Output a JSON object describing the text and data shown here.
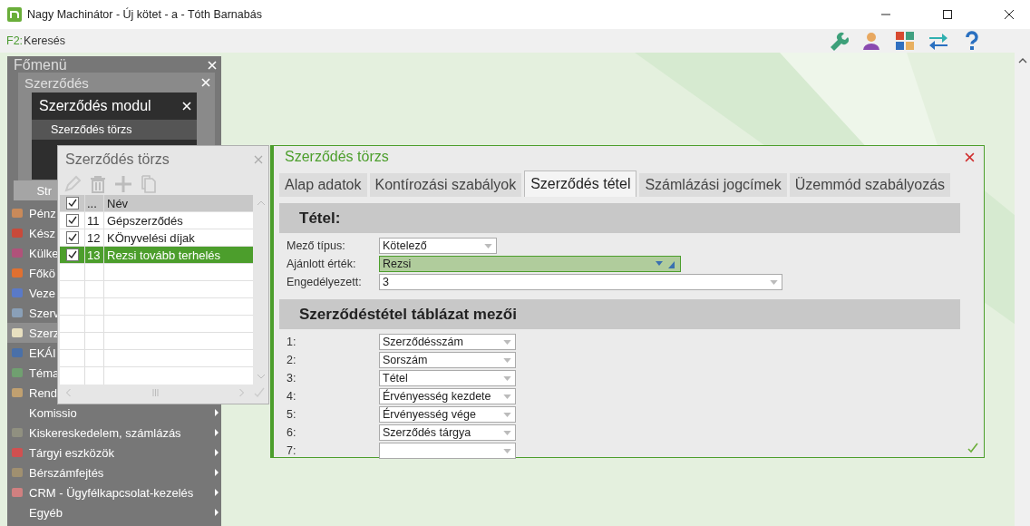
{
  "window": {
    "title": "Nagy Machinátor - Új kötet - a - Tóth Barnabás"
  },
  "toolbar": {
    "shortcut_key": "F2:",
    "shortcut_label": "Keresés"
  },
  "main_menu": {
    "title": "Főmenü",
    "items": [
      {
        "label": "Pénz",
        "selected": false,
        "has_icon": true,
        "arrow": false
      },
      {
        "label": "Kész",
        "selected": false,
        "has_icon": true,
        "arrow": false
      },
      {
        "label": "Külke",
        "selected": false,
        "has_icon": true,
        "arrow": false
      },
      {
        "label": "Főkö",
        "selected": false,
        "has_icon": true,
        "arrow": false
      },
      {
        "label": "Veze",
        "selected": false,
        "has_icon": true,
        "arrow": false
      },
      {
        "label": "Szerv",
        "selected": false,
        "has_icon": true,
        "arrow": false
      },
      {
        "label": "Szerz",
        "selected": true,
        "has_icon": true,
        "arrow": false
      },
      {
        "label": "EKÁI",
        "selected": false,
        "has_icon": true,
        "arrow": false
      },
      {
        "label": "Téma",
        "selected": false,
        "has_icon": true,
        "arrow": false
      },
      {
        "label": "Rend",
        "selected": false,
        "has_icon": true,
        "arrow": false
      },
      {
        "label": "Komissio",
        "selected": false,
        "has_icon": false,
        "arrow": true
      },
      {
        "label": "Kiskereskedelem, számlázás",
        "selected": false,
        "has_icon": true,
        "arrow": true
      },
      {
        "label": "Tárgyi eszközök",
        "selected": false,
        "has_icon": true,
        "arrow": true
      },
      {
        "label": "Bérszámfejtés",
        "selected": false,
        "has_icon": true,
        "arrow": true
      },
      {
        "label": "CRM - Ügyfélkapcsolat-kezelés",
        "selected": false,
        "has_icon": true,
        "arrow": true
      },
      {
        "label": "Egyéb",
        "selected": false,
        "has_icon": false,
        "arrow": true
      }
    ]
  },
  "submenu": {
    "title": "Szerződés",
    "button_label": "Str"
  },
  "module_menu": {
    "title": "Szerződés modul",
    "items": [
      {
        "label": "Szerződés törzs",
        "selected": true
      }
    ]
  },
  "list_window": {
    "title": "Szerződés törzs",
    "header_checked": true,
    "columns": [
      "...",
      "Név"
    ],
    "rows": [
      {
        "checked": true,
        "number": "11",
        "name": "Gépszerződés",
        "selected": false
      },
      {
        "checked": true,
        "number": "12",
        "name": "KÖnyvelési díjak",
        "selected": false
      },
      {
        "checked": true,
        "number": "13",
        "name": "Rezsi tovább terhelés",
        "selected": true
      }
    ]
  },
  "form": {
    "title": "Szerződés törzs",
    "tabs": [
      {
        "label": "Alap adatok",
        "selected": false
      },
      {
        "label": "Kontírozási szabályok",
        "selected": false
      },
      {
        "label": "Szerződés tétel",
        "selected": true
      },
      {
        "label": "Számlázási jogcímek",
        "selected": false
      },
      {
        "label": "Üzemmód szabályozás",
        "selected": false
      }
    ],
    "sections": [
      {
        "title": "Tétel:",
        "fields": [
          {
            "label": "Mező típus:",
            "value": "Kötelező",
            "focused": false
          },
          {
            "label": "Ajánlott érték:",
            "value": "Rezsi",
            "focused": true
          },
          {
            "label": "Engedélyezett:",
            "value": "3",
            "focused": false
          }
        ]
      },
      {
        "title": "Szerződéstétel táblázat mezői",
        "fields": [
          {
            "label": "1:",
            "value": "Szerződésszám",
            "focused": false
          },
          {
            "label": "2:",
            "value": "Sorszám",
            "focused": false
          },
          {
            "label": "3:",
            "value": "Tétel",
            "focused": false
          },
          {
            "label": "4:",
            "value": "Érvényesség kezdete",
            "focused": false
          },
          {
            "label": "5:",
            "value": "Érvényesség vége",
            "focused": false
          },
          {
            "label": "6:",
            "value": "Szerződés tárgya",
            "focused": false
          },
          {
            "label": "7:",
            "focused": false
          }
        ]
      }
    ]
  }
}
